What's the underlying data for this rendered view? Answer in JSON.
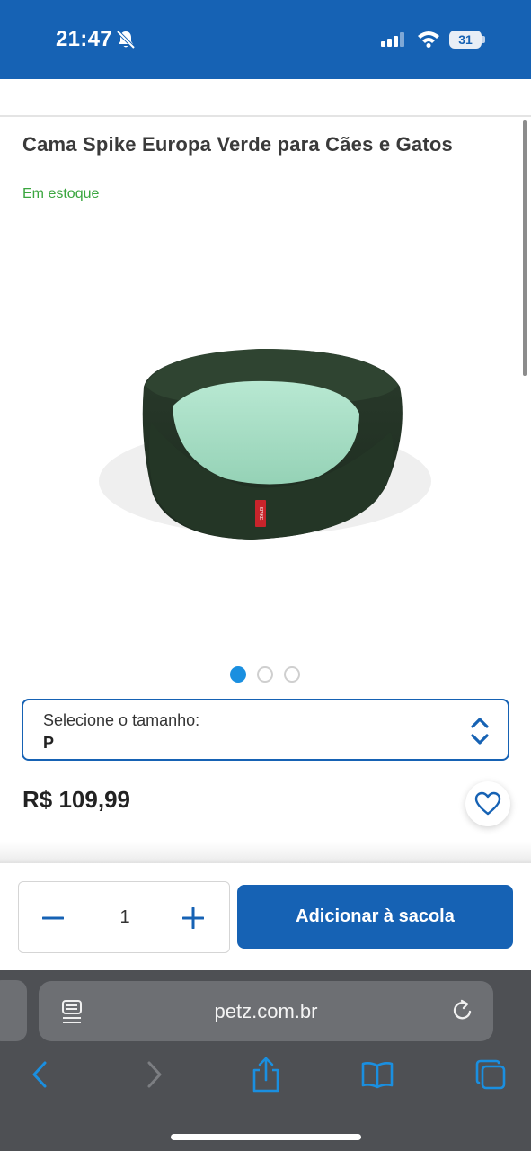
{
  "status_bar": {
    "time": "21:47",
    "battery": "31",
    "icons": [
      "bell-slash-icon",
      "signal-icon",
      "wifi-icon",
      "battery-icon"
    ],
    "background": "#1662b4"
  },
  "product": {
    "title": "Cama Spike Europa Verde para Cães e Gatos",
    "stock_status": "Em estoque",
    "stock_color": "#3aa63f",
    "image_tag": "SPIKE",
    "carousel": {
      "total": 3,
      "active_index": 0
    }
  },
  "size_select": {
    "label": "Selecione o tamanho:",
    "value": "P"
  },
  "price": "R$ 109,99",
  "purchase": {
    "quantity": "1",
    "add_button_label": "Adicionar à sacola",
    "accent": "#1662b4"
  },
  "browser": {
    "url": "petz.com.br",
    "toolbar": [
      "back-icon",
      "forward-icon",
      "share-icon",
      "bookmarks-icon",
      "tabs-icon"
    ]
  }
}
